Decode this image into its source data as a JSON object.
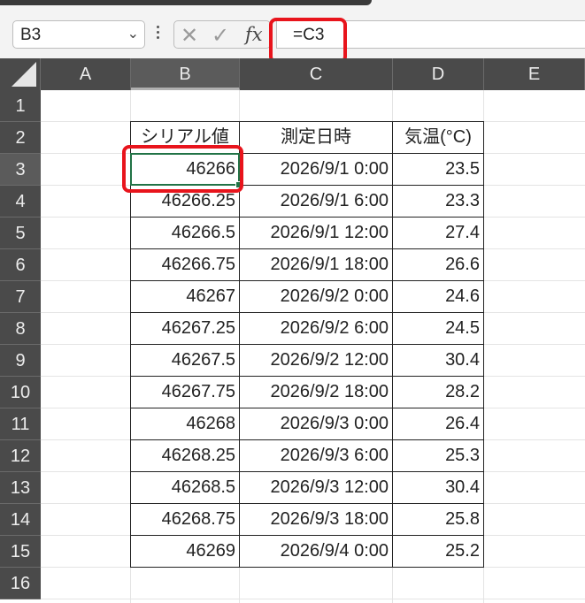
{
  "name_box": {
    "value": "B3",
    "dropdown_icon": "chevron-down-icon"
  },
  "formula_bar": {
    "cancel_icon": "close-icon",
    "enter_icon": "check-icon",
    "fx_label": "fx",
    "formula": "=C3"
  },
  "sheet": {
    "columns": [
      "A",
      "B",
      "C",
      "D",
      "E"
    ],
    "rows": [
      "1",
      "2",
      "3",
      "4",
      "5",
      "6",
      "7",
      "8",
      "9",
      "10",
      "11",
      "12",
      "13",
      "14",
      "15",
      "16"
    ],
    "selected_cell": "B3",
    "header": [
      "シリアル値",
      "測定日時",
      "気温(°C)"
    ],
    "data": [
      [
        "46266",
        "2026/9/1 0:00",
        "23.5"
      ],
      [
        "46266.25",
        "2026/9/1 6:00",
        "23.3"
      ],
      [
        "46266.5",
        "2026/9/1 12:00",
        "27.4"
      ],
      [
        "46266.75",
        "2026/9/1 18:00",
        "26.6"
      ],
      [
        "46267",
        "2026/9/2 0:00",
        "24.6"
      ],
      [
        "46267.25",
        "2026/9/2 6:00",
        "24.5"
      ],
      [
        "46267.5",
        "2026/9/2 12:00",
        "30.4"
      ],
      [
        "46267.75",
        "2026/9/2 18:00",
        "28.2"
      ],
      [
        "46268",
        "2026/9/3 0:00",
        "26.4"
      ],
      [
        "46268.25",
        "2026/9/3 6:00",
        "25.3"
      ],
      [
        "46268.5",
        "2026/9/3 12:00",
        "30.4"
      ],
      [
        "46268.75",
        "2026/9/3 18:00",
        "25.8"
      ],
      [
        "46269",
        "2026/9/4 0:00",
        "25.2"
      ]
    ]
  },
  "colors": {
    "highlight": "#e8141c",
    "selection": "#217346",
    "header_bg": "#4a4a4a"
  }
}
